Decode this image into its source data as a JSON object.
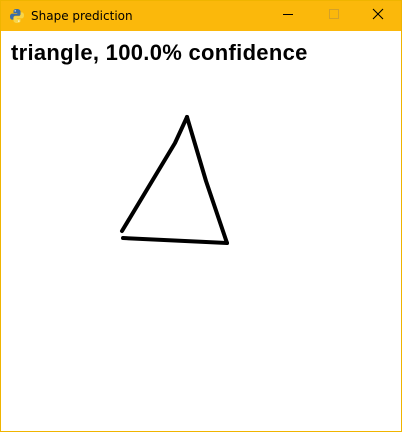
{
  "window": {
    "title": "Shape prediction",
    "accent_color": "#fbb80b",
    "icons": {
      "app": "python-icon",
      "minimize": "minimize-icon",
      "maximize": "maximize-icon",
      "close": "close-icon"
    }
  },
  "main": {
    "prediction_text": "triangle, 100.0% confidence",
    "drawing": {
      "shape": "triangle",
      "stroke_color": "#000000"
    }
  }
}
